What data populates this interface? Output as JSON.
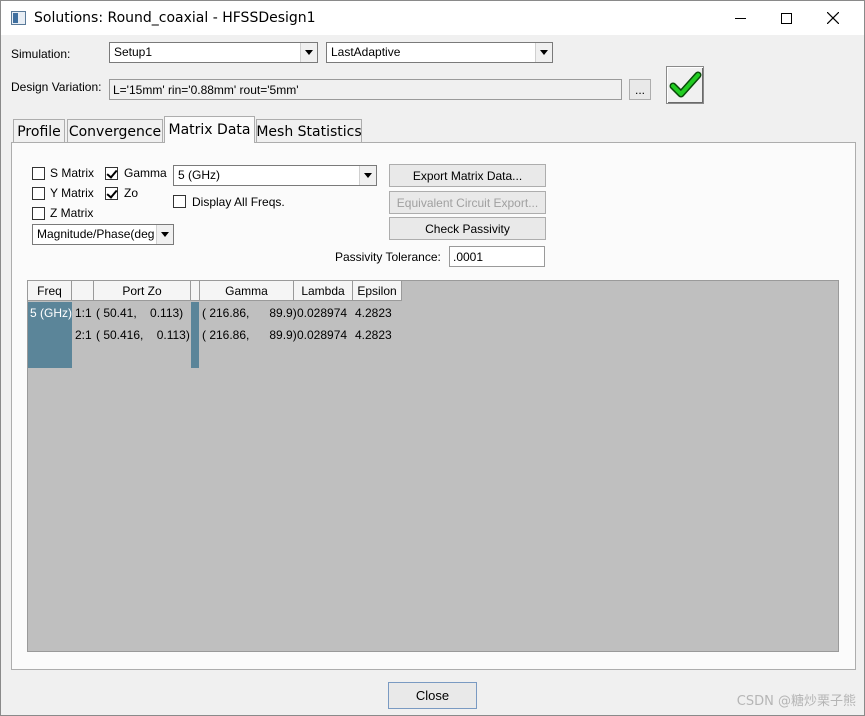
{
  "window": {
    "title": "Solutions: Round_coaxial - HFSSDesign1",
    "min_glyph": "—",
    "max_glyph": "☐",
    "close_glyph": "✕"
  },
  "simulation": {
    "label": "Simulation:",
    "setup_value": "Setup1",
    "pass_value": "LastAdaptive"
  },
  "design_variation": {
    "label": "Design Variation:",
    "value": "L='15mm' rin='0.88mm' rout='5mm'",
    "browse_label": "..."
  },
  "tabs": [
    {
      "label": "Profile"
    },
    {
      "label": "Convergence"
    },
    {
      "label": "Matrix Data"
    },
    {
      "label": "Mesh Statistics"
    }
  ],
  "active_tab": "Matrix Data",
  "matrix": {
    "s_matrix": {
      "label": "S Matrix",
      "checked": false
    },
    "y_matrix": {
      "label": "Y Matrix",
      "checked": false
    },
    "z_matrix": {
      "label": "Z Matrix",
      "checked": false
    },
    "gamma": {
      "label": "Gamma",
      "checked": true
    },
    "zo": {
      "label": "Zo",
      "checked": true
    },
    "display_all": {
      "label": "Display All Freqs.",
      "checked": false
    },
    "freq_value": "5 (GHz)",
    "format_value": "Magnitude/Phase(deg",
    "export_label": "Export Matrix Data...",
    "equiv_label": "Equivalent Circuit Export...",
    "passivity_label": "Check Passivity",
    "tolerance_label": "Passivity Tolerance:",
    "tolerance_value": ".0001"
  },
  "grid": {
    "headers": {
      "freq": "Freq",
      "port_zo": "Port Zo",
      "gamma": "Gamma",
      "lambda": "Lambda",
      "epsilon": "Epsilon"
    },
    "rows": [
      {
        "freq": "5 (GHz)",
        "port": "1:1",
        "zo": "( 50.41,    0.113)",
        "gamma": "( 216.86,      89.9)",
        "lambda": "0.028974",
        "epsilon": "4.2823"
      },
      {
        "freq": "",
        "port": "2:1",
        "zo": "( 50.416,    0.113)",
        "gamma": "( 216.86,      89.9)",
        "lambda": "0.028974",
        "epsilon": "4.2823"
      }
    ]
  },
  "close_label": "Close",
  "watermark": "CSDN @糖炒栗子熊",
  "colors": {
    "accent": "#5b8599",
    "check": "#22cc22"
  }
}
